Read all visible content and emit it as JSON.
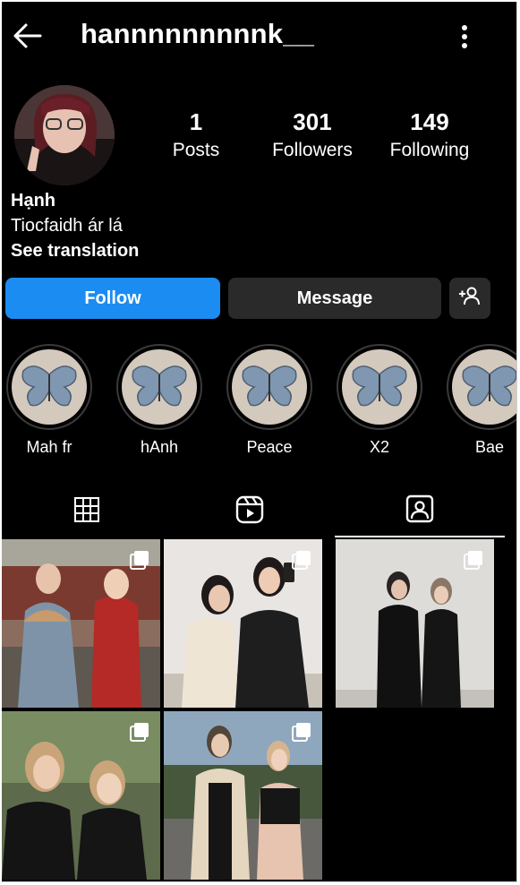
{
  "header": {
    "back_icon": "arrow-left-icon",
    "username": "hannnnnnnnnk__",
    "menu_icon": "more-vertical-icon"
  },
  "profile": {
    "stats": [
      {
        "value": "1",
        "label": "Posts"
      },
      {
        "value": "301",
        "label": "Followers"
      },
      {
        "value": "149",
        "label": "Following"
      }
    ],
    "name": "Hạnh",
    "bio": "Tiocfaidh ár lá",
    "see_translation": "See translation"
  },
  "actions": {
    "follow": "Follow",
    "message": "Message",
    "add_user_icon": "person-add-icon"
  },
  "highlights": [
    {
      "label": "Mah fr"
    },
    {
      "label": "hAnh"
    },
    {
      "label": "Peace"
    },
    {
      "label": "X2"
    },
    {
      "label": "Bae"
    }
  ],
  "tabs": [
    {
      "icon": "grid-icon",
      "active": false
    },
    {
      "icon": "reels-icon",
      "active": false
    },
    {
      "icon": "tagged-icon",
      "active": true
    }
  ],
  "colors": {
    "background": "#000000",
    "follow_button": "#1b8cf2",
    "secondary_button": "#2a2a2a"
  }
}
